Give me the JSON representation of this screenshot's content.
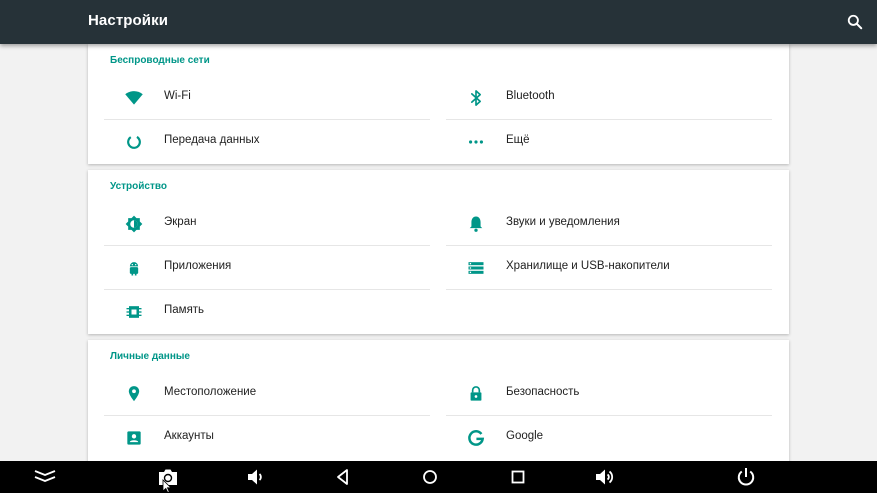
{
  "header": {
    "title": "Настройки",
    "search_icon": "search-icon",
    "background": "#263238"
  },
  "accent_color": "#009688",
  "sections": [
    {
      "title": "Беспроводные сети",
      "items": [
        {
          "label": "Wi-Fi",
          "icon": "wifi-icon"
        },
        {
          "label": "Bluetooth",
          "icon": "bluetooth-icon"
        },
        {
          "label": "Передача данных",
          "icon": "data-usage-icon"
        },
        {
          "label": "Ещё",
          "icon": "more-icon"
        }
      ]
    },
    {
      "title": "Устройство",
      "items": [
        {
          "label": "Экран",
          "icon": "brightness-icon"
        },
        {
          "label": "Звуки и уведомления",
          "icon": "bell-icon"
        },
        {
          "label": "Приложения",
          "icon": "android-icon"
        },
        {
          "label": "Хранилище и USB-накопители",
          "icon": "storage-icon"
        },
        {
          "label": "Память",
          "icon": "memory-icon"
        }
      ]
    },
    {
      "title": "Личные данные",
      "items": [
        {
          "label": "Местоположение",
          "icon": "location-icon"
        },
        {
          "label": "Безопасность",
          "icon": "lock-icon"
        },
        {
          "label": "Аккаунты",
          "icon": "account-icon"
        },
        {
          "label": "Google",
          "icon": "google-icon"
        }
      ]
    }
  ],
  "navbar": {
    "buttons": [
      "hide-bar-icon",
      "screenshot-icon",
      "volume-down-icon",
      "back-icon",
      "home-icon",
      "recents-icon",
      "volume-up-icon",
      "power-icon"
    ]
  }
}
